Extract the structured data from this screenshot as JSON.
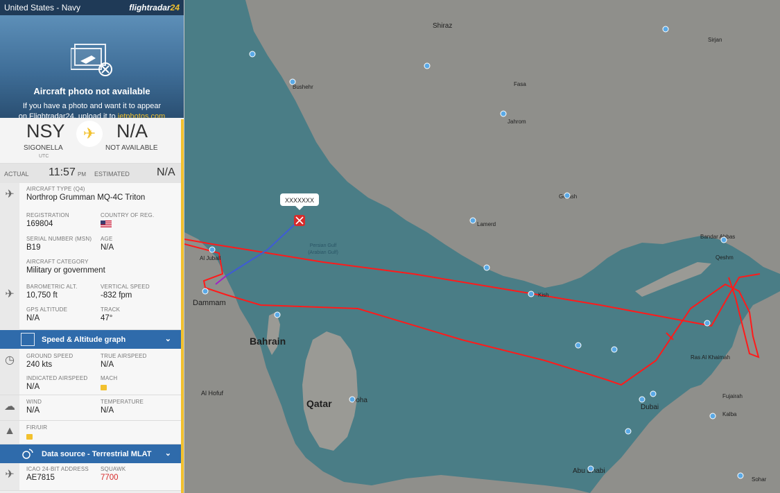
{
  "sidebar": {
    "title": "United States - Navy",
    "brand": {
      "text": "flightradar",
      "num": "24"
    },
    "photo": {
      "title": "Aircraft photo not available",
      "line1": "If you have a photo and want it to appear",
      "line2_prefix": "on Flightradar24, upload it to ",
      "link": "jetphotos.com"
    },
    "route": {
      "from_code": "NSY",
      "from_name": "SIGONELLA",
      "from_tz": "UTC",
      "to_code": "N/A",
      "to_name": "NOT AVAILABLE"
    },
    "times": {
      "actual_label": "ACTUAL",
      "actual_time": "11:57",
      "actual_ampm": "PM",
      "estimated_label": "ESTIMATED",
      "estimated_time": "N/A"
    },
    "aircraft_type": {
      "label": "AIRCRAFT TYPE (Q4)",
      "value": "Northrop Grumman MQ-4C Triton"
    },
    "registration": {
      "label": "REGISTRATION",
      "value": "169804"
    },
    "country": {
      "label": "COUNTRY OF REG.",
      "flag": "us-flag"
    },
    "serial": {
      "label": "SERIAL NUMBER (MSN)",
      "value": "B19"
    },
    "age": {
      "label": "AGE",
      "value": "N/A"
    },
    "category": {
      "label": "AIRCRAFT CATEGORY",
      "value": "Military or government"
    },
    "baro_alt": {
      "label": "BAROMETRIC ALT.",
      "value": "10,750 ft"
    },
    "vspeed": {
      "label": "VERTICAL SPEED",
      "value": "-832 fpm"
    },
    "gps_alt": {
      "label": "GPS ALTITUDE",
      "value": "N/A"
    },
    "track": {
      "label": "TRACK",
      "value": "47°"
    },
    "speed_graph": {
      "label": "Speed & Altitude graph"
    },
    "ground_speed": {
      "label": "GROUND SPEED",
      "value": "240 kts"
    },
    "true_airspeed": {
      "label": "TRUE AIRSPEED",
      "value": "N/A"
    },
    "ind_airspeed": {
      "label": "INDICATED AIRSPEED",
      "value": "N/A"
    },
    "mach": {
      "label": "MACH"
    },
    "wind": {
      "label": "WIND",
      "value": "N/A"
    },
    "temperature": {
      "label": "TEMPERATURE",
      "value": "N/A"
    },
    "fir": {
      "label": "FIR/UIR"
    },
    "data_source": {
      "label": "Data source - Terrestrial MLAT"
    },
    "icao": {
      "label": "ICAO 24-BIT ADDRESS",
      "value": "AE7815"
    },
    "squawk": {
      "label": "SQUAWK",
      "value": "7700"
    }
  },
  "map": {
    "callout": "XXXXXXX",
    "water_label_1": "Persian Gulf",
    "water_label_2": "(Arabian Gulf)",
    "places": {
      "shiraz": "Shiraz",
      "bushehr": "Bushehr",
      "jahrom": "Jahrom",
      "fasa": "Fasa",
      "bandar_abbas": "Bandar Abbas",
      "qeshm": "Qeshm",
      "kish": "Kish",
      "lamerd": "Lamerd",
      "gerash": "Gerash",
      "al_jubail": "Al Jubail",
      "dammam": "Dammam",
      "bahrain": "Bahrain",
      "qatar": "Qatar",
      "doha": "Doha",
      "al_hofuf": "Al Hofuf",
      "dubai": "Dubai",
      "abu_dhabi": "Abu Dhabi",
      "ras_al_khaimah": "Ras Al Khaimah",
      "sohar": "Sohar",
      "sirjan": "Sirjan",
      "fujairah": "Fujairah",
      "kalba": "Kalba"
    },
    "colors": {
      "water": "#4a7d86",
      "land": "#8c8c88",
      "track": "#ff1a1a",
      "aircraft": "#d62b2b"
    }
  }
}
